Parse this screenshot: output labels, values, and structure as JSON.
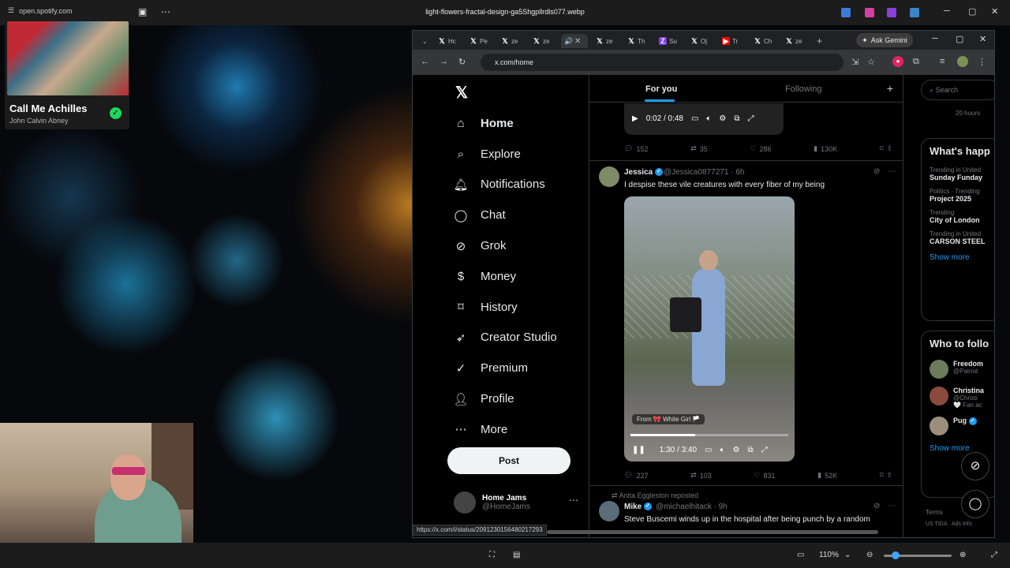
{
  "viewer": {
    "source_url": "open.spotify.com",
    "filename": "light-flowers-fractal-design-ga5Shgpllrdls077.webp",
    "zoom": "110%"
  },
  "spotify": {
    "track": "Call Me Achilles",
    "artist": "John Calvin Abney"
  },
  "browser": {
    "gemini_label": "Ask Gemini",
    "url": "x.com/home",
    "status_url": "https://x.com/i/status/2091230156480217293",
    "tabs": [
      "Hc",
      "Pe",
      "ze",
      "ze",
      "",
      "ze",
      "Th",
      "Su",
      "Oj",
      "Tr",
      "Ch",
      "ze"
    ]
  },
  "nav": {
    "items": [
      "Home",
      "Explore",
      "Notifications",
      "Chat",
      "Grok",
      "Money",
      "History",
      "Creator Studio",
      "Premium",
      "Profile",
      "More"
    ],
    "post_label": "Post",
    "account_name": "Home Jams",
    "account_handle": "@HomeJams"
  },
  "timeline": {
    "tab_for_you": "For you",
    "tab_following": "Following",
    "video1": {
      "time": "0:02 / 0:48",
      "replies": "152",
      "reposts": "35",
      "likes": "286",
      "views": "130K"
    },
    "tweet2": {
      "name": "Jessica",
      "handle": "@Jessica0877271",
      "age": "· 6h",
      "text": "I despise these vile creatures with every fiber of my being",
      "from_badge": "From 🎀 White Girl 🏳️",
      "time": "1:30 / 3:40",
      "progress": 0.41,
      "replies": "227",
      "reposts": "103",
      "likes": "831",
      "views": "52K"
    },
    "tweet3": {
      "reposted_by": "Anita Eggleston reposted",
      "name": "Mike",
      "handle": "@michaelhitack",
      "age": "· 9h",
      "text": "Steve Buscemi winds up in the hospital after being punch by a random"
    }
  },
  "right": {
    "search_placeholder": "Search",
    "live_time": "20 hours",
    "whats_happening": "What's happ",
    "trends": [
      {
        "context": "Trending in United",
        "title": "Sunday Funday"
      },
      {
        "context": "Politics · Trending",
        "title": "Project 2025"
      },
      {
        "context": "Trending",
        "title": "City of London"
      },
      {
        "context": "Trending in United",
        "title": "CARSON STEEL"
      }
    ],
    "show_more": "Show more",
    "who_to_follow": "Who to follo",
    "follow": [
      {
        "name": "Freedom",
        "handle": "@Patriot"
      },
      {
        "name": "Christina",
        "handle": "@Christi",
        "extra": "🤍 Fan ac"
      },
      {
        "name": "Pug",
        "handle": ""
      }
    ],
    "show_more_2": "Show more",
    "footer_terms": "Terms",
    "footer_ads": "US TIDA · Ads Info"
  }
}
